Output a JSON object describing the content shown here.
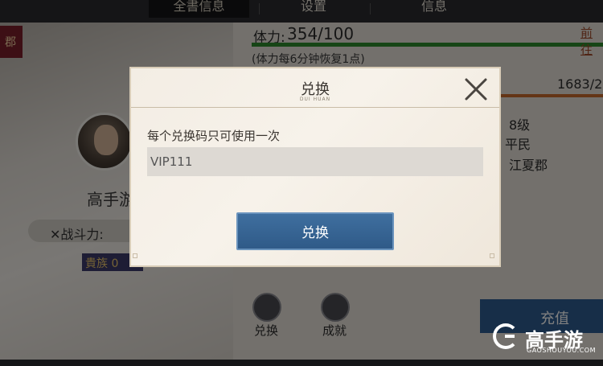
{
  "top_tabs": [
    "全書信息",
    "设置",
    "信息"
  ],
  "left_panel": {
    "side_badge": "郡",
    "player_name": "高手游",
    "power_label": "✕战斗力:",
    "noble_badge": "貴族 0"
  },
  "right_panel": {
    "stamina_label": "体力:",
    "stamina_value": "354/100",
    "stamina_note": "(体力每6分钟恢复1点)",
    "goto_link": "前往",
    "exp_value": "1683/2",
    "level": "8级",
    "identity": "平民",
    "region": "江夏郡",
    "icons": [
      {
        "label": "兑换",
        "icon": "coins-icon"
      },
      {
        "label": "成就",
        "icon": "trophy-icon"
      }
    ],
    "recharge_label": "充值"
  },
  "dialog": {
    "title": "兑换",
    "subtitle": "DUI HUAN",
    "hint": "每个兑换码只可使用一次",
    "code_value": "VIP111",
    "confirm_label": "兑换"
  },
  "watermark": {
    "brand": "高手游",
    "url": "GAOSHOUYOU.COM"
  },
  "colors": {
    "stamina_bar": "#2d8a2d",
    "exp_bar": "#c86a2c",
    "button_blue": "#2f5a88",
    "overlay": "rgba(0,0,0,0.5)"
  }
}
